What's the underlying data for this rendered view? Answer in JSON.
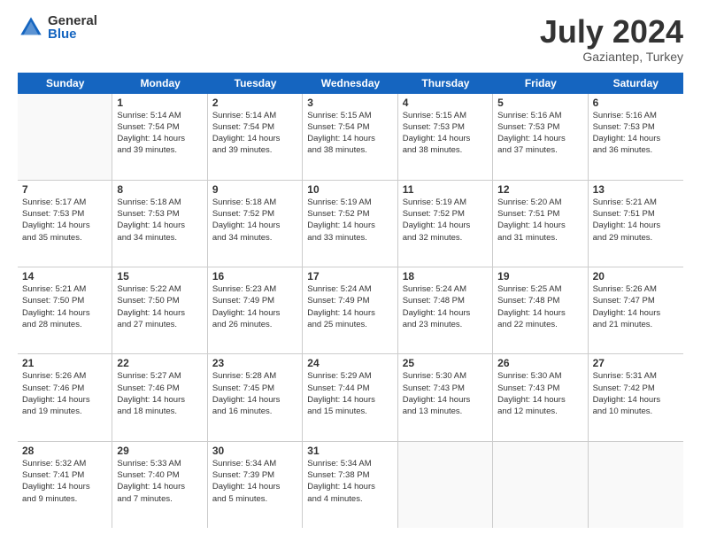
{
  "logo": {
    "general": "General",
    "blue": "Blue"
  },
  "title": "July 2024",
  "subtitle": "Gaziantep, Turkey",
  "weekdays": [
    "Sunday",
    "Monday",
    "Tuesday",
    "Wednesday",
    "Thursday",
    "Friday",
    "Saturday"
  ],
  "weeks": [
    [
      {
        "day": "",
        "info": ""
      },
      {
        "day": "1",
        "info": "Sunrise: 5:14 AM\nSunset: 7:54 PM\nDaylight: 14 hours\nand 39 minutes."
      },
      {
        "day": "2",
        "info": "Sunrise: 5:14 AM\nSunset: 7:54 PM\nDaylight: 14 hours\nand 39 minutes."
      },
      {
        "day": "3",
        "info": "Sunrise: 5:15 AM\nSunset: 7:54 PM\nDaylight: 14 hours\nand 38 minutes."
      },
      {
        "day": "4",
        "info": "Sunrise: 5:15 AM\nSunset: 7:53 PM\nDaylight: 14 hours\nand 38 minutes."
      },
      {
        "day": "5",
        "info": "Sunrise: 5:16 AM\nSunset: 7:53 PM\nDaylight: 14 hours\nand 37 minutes."
      },
      {
        "day": "6",
        "info": "Sunrise: 5:16 AM\nSunset: 7:53 PM\nDaylight: 14 hours\nand 36 minutes."
      }
    ],
    [
      {
        "day": "7",
        "info": "Sunrise: 5:17 AM\nSunset: 7:53 PM\nDaylight: 14 hours\nand 35 minutes."
      },
      {
        "day": "8",
        "info": "Sunrise: 5:18 AM\nSunset: 7:53 PM\nDaylight: 14 hours\nand 34 minutes."
      },
      {
        "day": "9",
        "info": "Sunrise: 5:18 AM\nSunset: 7:52 PM\nDaylight: 14 hours\nand 34 minutes."
      },
      {
        "day": "10",
        "info": "Sunrise: 5:19 AM\nSunset: 7:52 PM\nDaylight: 14 hours\nand 33 minutes."
      },
      {
        "day": "11",
        "info": "Sunrise: 5:19 AM\nSunset: 7:52 PM\nDaylight: 14 hours\nand 32 minutes."
      },
      {
        "day": "12",
        "info": "Sunrise: 5:20 AM\nSunset: 7:51 PM\nDaylight: 14 hours\nand 31 minutes."
      },
      {
        "day": "13",
        "info": "Sunrise: 5:21 AM\nSunset: 7:51 PM\nDaylight: 14 hours\nand 29 minutes."
      }
    ],
    [
      {
        "day": "14",
        "info": "Sunrise: 5:21 AM\nSunset: 7:50 PM\nDaylight: 14 hours\nand 28 minutes."
      },
      {
        "day": "15",
        "info": "Sunrise: 5:22 AM\nSunset: 7:50 PM\nDaylight: 14 hours\nand 27 minutes."
      },
      {
        "day": "16",
        "info": "Sunrise: 5:23 AM\nSunset: 7:49 PM\nDaylight: 14 hours\nand 26 minutes."
      },
      {
        "day": "17",
        "info": "Sunrise: 5:24 AM\nSunset: 7:49 PM\nDaylight: 14 hours\nand 25 minutes."
      },
      {
        "day": "18",
        "info": "Sunrise: 5:24 AM\nSunset: 7:48 PM\nDaylight: 14 hours\nand 23 minutes."
      },
      {
        "day": "19",
        "info": "Sunrise: 5:25 AM\nSunset: 7:48 PM\nDaylight: 14 hours\nand 22 minutes."
      },
      {
        "day": "20",
        "info": "Sunrise: 5:26 AM\nSunset: 7:47 PM\nDaylight: 14 hours\nand 21 minutes."
      }
    ],
    [
      {
        "day": "21",
        "info": "Sunrise: 5:26 AM\nSunset: 7:46 PM\nDaylight: 14 hours\nand 19 minutes."
      },
      {
        "day": "22",
        "info": "Sunrise: 5:27 AM\nSunset: 7:46 PM\nDaylight: 14 hours\nand 18 minutes."
      },
      {
        "day": "23",
        "info": "Sunrise: 5:28 AM\nSunset: 7:45 PM\nDaylight: 14 hours\nand 16 minutes."
      },
      {
        "day": "24",
        "info": "Sunrise: 5:29 AM\nSunset: 7:44 PM\nDaylight: 14 hours\nand 15 minutes."
      },
      {
        "day": "25",
        "info": "Sunrise: 5:30 AM\nSunset: 7:43 PM\nDaylight: 14 hours\nand 13 minutes."
      },
      {
        "day": "26",
        "info": "Sunrise: 5:30 AM\nSunset: 7:43 PM\nDaylight: 14 hours\nand 12 minutes."
      },
      {
        "day": "27",
        "info": "Sunrise: 5:31 AM\nSunset: 7:42 PM\nDaylight: 14 hours\nand 10 minutes."
      }
    ],
    [
      {
        "day": "28",
        "info": "Sunrise: 5:32 AM\nSunset: 7:41 PM\nDaylight: 14 hours\nand 9 minutes."
      },
      {
        "day": "29",
        "info": "Sunrise: 5:33 AM\nSunset: 7:40 PM\nDaylight: 14 hours\nand 7 minutes."
      },
      {
        "day": "30",
        "info": "Sunrise: 5:34 AM\nSunset: 7:39 PM\nDaylight: 14 hours\nand 5 minutes."
      },
      {
        "day": "31",
        "info": "Sunrise: 5:34 AM\nSunset: 7:38 PM\nDaylight: 14 hours\nand 4 minutes."
      },
      {
        "day": "",
        "info": ""
      },
      {
        "day": "",
        "info": ""
      },
      {
        "day": "",
        "info": ""
      }
    ]
  ]
}
